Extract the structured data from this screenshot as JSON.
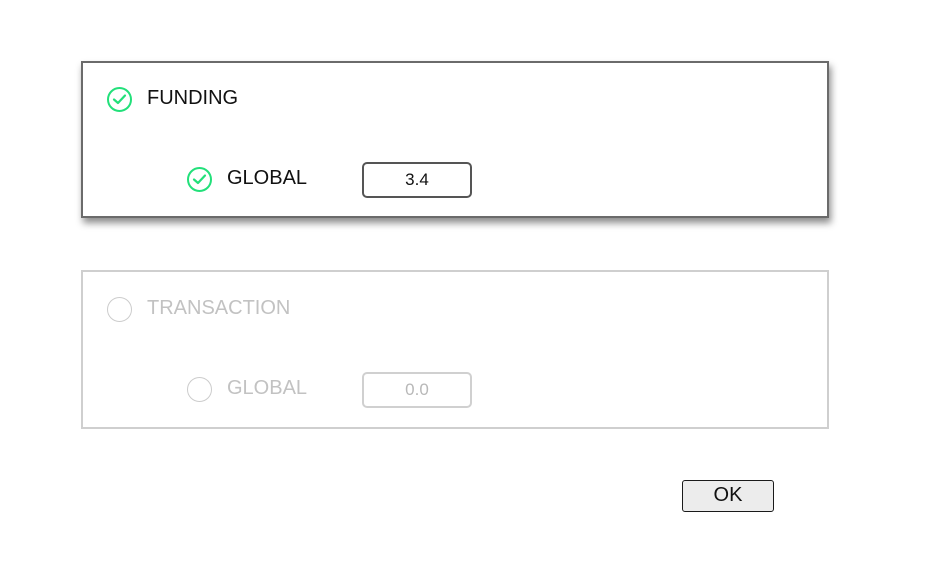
{
  "funding": {
    "label": "FUNDING",
    "checked": true,
    "global": {
      "label": "GLOBAL",
      "checked": true,
      "value": "3.4"
    }
  },
  "transaction": {
    "label": "TRANSACTION",
    "checked": false,
    "global": {
      "label": "GLOBAL",
      "checked": false,
      "value": "0.0"
    }
  },
  "ok_label": "OK",
  "colors": {
    "check_accent": "#22e07a",
    "active_border": "#555555",
    "disabled_gray": "#c2c2c2"
  }
}
